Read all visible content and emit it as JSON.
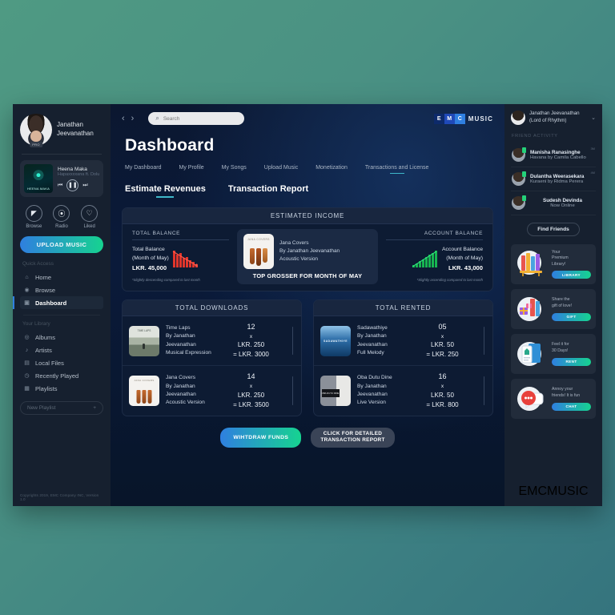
{
  "brand": {
    "b1": "E",
    "b2": "M",
    "b3": "C",
    "word": "MUSIC",
    "accent": "#2f7fe0",
    "accent2": "#16d390"
  },
  "left_sidebar": {
    "profile": {
      "name": "Janathan\nJeevanathan",
      "badge": "PRO"
    },
    "player": {
      "title": "Heena Maka",
      "subtitle": "Hapaxxxxana ft. Doluy",
      "cover_caption": "HEENA MAKA",
      "prev": "⏮",
      "play": "❚❚",
      "next": "⏭"
    },
    "quick_icons": [
      {
        "label": "Browse",
        "glyph": "◤"
      },
      {
        "label": "Radio",
        "glyph": "⦿"
      },
      {
        "label": "Liked",
        "glyph": "♡"
      }
    ],
    "upload_label": "UPLOAD MUSIC",
    "quick_access_title": "Quick Access",
    "quick_access": [
      {
        "label": "Home",
        "glyph": "⌂",
        "active": false
      },
      {
        "label": "Browse",
        "glyph": "◉",
        "active": false
      },
      {
        "label": "Dashboard",
        "glyph": "▣",
        "active": true
      }
    ],
    "library_title": "Your Library",
    "library": [
      {
        "label": "Albums",
        "glyph": "◎"
      },
      {
        "label": "Artists",
        "glyph": "♪"
      },
      {
        "label": "Local Files",
        "glyph": "▤"
      },
      {
        "label": "Recently Played",
        "glyph": "◷"
      },
      {
        "label": "Playlists",
        "glyph": "▦"
      }
    ],
    "new_playlist": "New Playlist",
    "new_playlist_plus": "+",
    "copyright": "Copyrights 2019, EMC Company INC, Version 1.0"
  },
  "header": {
    "back": "‹",
    "forward": "›",
    "search_placeholder": "Search",
    "search_value": "",
    "search_icon": "⌕"
  },
  "page": {
    "title": "Dashboard"
  },
  "tabs": [
    {
      "label": "My Dashboard",
      "active": false
    },
    {
      "label": "My Profile",
      "active": false
    },
    {
      "label": "My Songs",
      "active": false
    },
    {
      "label": "Upload Music",
      "active": false
    },
    {
      "label": "Monetization",
      "active": false
    },
    {
      "label": "Transactions and License",
      "active": true
    }
  ],
  "subtabs": [
    {
      "label": "Estimate Revenues",
      "active": true
    },
    {
      "label": "Transaction Report",
      "active": false
    }
  ],
  "estimated_income": {
    "header": "ESTIMATED INCOME",
    "total_balance": {
      "title": "TOTAL BALANCE",
      "line1": "Total Balance",
      "line2": "(Month of May)",
      "amount": "LKR. 45,000",
      "note": "*Slightly descending compared to last month"
    },
    "account_balance": {
      "title": "ACCOUNT BALANCE",
      "line1": "Account Balance",
      "line2": "(Month of May)",
      "amount": "LKR. 43,000",
      "note": "*Slightly ascending compared to last month"
    },
    "top_grosser": {
      "cover_caption": "JANA COVERS",
      "title": "Jana Covers",
      "artist": "By Janathan Jeevanathan",
      "version": "Acoustic Version",
      "banner": "TOP GROSSER FOR MONTH OF MAY"
    }
  },
  "total_downloads": {
    "header": "TOTAL DOWNLOADS",
    "rows": [
      {
        "thumb_caption": "TIME LAPS",
        "title": "Time Laps",
        "artist": "By Janathan Jeevanathan",
        "version": "Musical Expression",
        "count": "12",
        "times": "x",
        "unit_price": "LKR. 250",
        "total": "= LKR. 3000"
      },
      {
        "thumb_caption": "JANA COVERS",
        "title": "Jana Covers",
        "artist": "By Janathan Jeevanathan",
        "version": "Acoustic Version",
        "count": "14",
        "times": "x",
        "unit_price": "LKR. 250",
        "total": "= LKR. 3500"
      }
    ]
  },
  "total_rented": {
    "header": "TOTAL RENTED",
    "rows": [
      {
        "thumb_caption": "SADAWATHIYE",
        "title": "Sadawathiye",
        "artist": "By Janathan Jeevanathan",
        "version": "Full Melody",
        "count": "05",
        "times": "x",
        "unit_price": "LKR. 50",
        "total": "= LKR. 250"
      },
      {
        "thumb_caption": "OBA DUTU DINE",
        "title": "Oba Dutu Dine",
        "artist": "By Janathan Jeevanathan",
        "version": "Live Version",
        "count": "16",
        "times": "x",
        "unit_price": "LKR. 50",
        "total": "= LKR. 800"
      }
    ]
  },
  "actions": {
    "withdraw": "WIHTDRAW FUNDS",
    "detail_line1": "CLICK FOR DETAILED",
    "detail_line2": "TRANSACTION REPORT"
  },
  "right_sidebar": {
    "user": {
      "name": "Janathan Jeevanathan",
      "subtitle": "(Lord of Rhythm)",
      "chevron": "⌄"
    },
    "activity_title": "FRIEND ACTIVITY",
    "friends": [
      {
        "name": "Manisha Ranasinghe",
        "sub": "Havana by Camila Cabello",
        "time": "3M"
      },
      {
        "name": "Dulantha Weerasekara",
        "sub": "Kuraeni by Ridma Perera",
        "time": "4M"
      },
      {
        "name": "Sudesh Devinda",
        "sub": "Now Online",
        "time": ""
      }
    ],
    "find_friends": "Find Friends",
    "ads": [
      {
        "art": "library",
        "line1": "Your",
        "line2": "Premium",
        "line3": "Library!",
        "button": "LIBRARY"
      },
      {
        "art": "gift",
        "line1": "Share the",
        "line2": "gift of love!",
        "line3": "",
        "button": "GIFT"
      },
      {
        "art": "rent",
        "line1": "Feel it for",
        "line2": "30 Days!",
        "line3": "",
        "button": "RENT"
      },
      {
        "art": "chat",
        "line1": "Annoy your",
        "line2": "friends! It is fun",
        "line3": "",
        "button": "CHAT"
      }
    ]
  },
  "chart_data": [
    {
      "type": "bar",
      "title": "Total Balance trend",
      "categories": [
        "1",
        "2",
        "3",
        "4",
        "5",
        "6",
        "7",
        "8"
      ],
      "values": [
        95,
        72,
        80,
        58,
        64,
        42,
        36,
        22
      ],
      "color": "#e0352b",
      "trend": "descending",
      "xlabel": "",
      "ylabel": "",
      "ylim": [
        0,
        100
      ],
      "grid": false,
      "legend": "none"
    },
    {
      "type": "bar",
      "title": "Account Balance trend",
      "categories": [
        "1",
        "2",
        "3",
        "4",
        "5",
        "6",
        "7",
        "8"
      ],
      "values": [
        18,
        26,
        34,
        44,
        56,
        68,
        82,
        96
      ],
      "color": "#17b451",
      "trend": "ascending",
      "xlabel": "",
      "ylabel": "",
      "ylim": [
        0,
        100
      ],
      "grid": false,
      "legend": "none"
    }
  ]
}
